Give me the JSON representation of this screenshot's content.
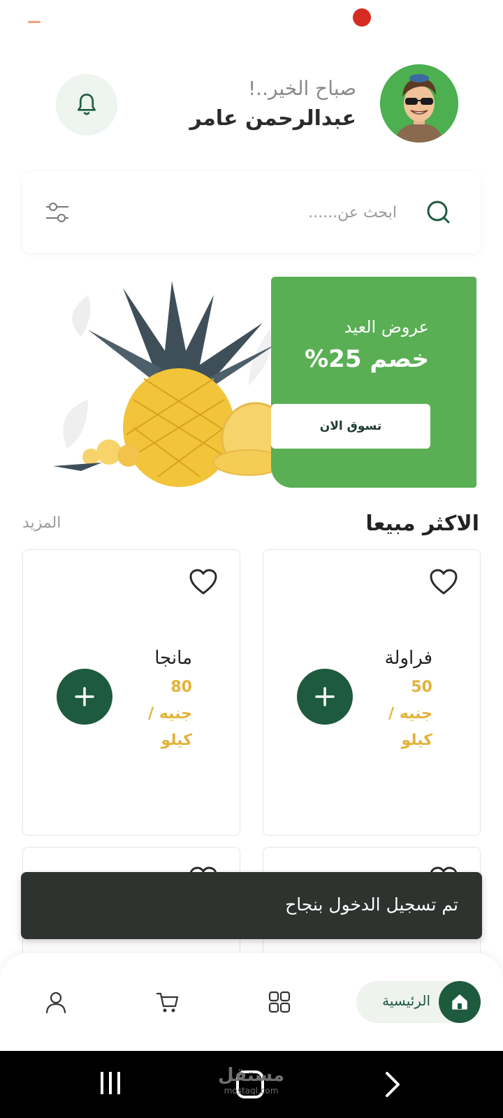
{
  "header": {
    "greeting": "صباح الخير..!",
    "username": "عبدالرحمن عامر"
  },
  "search": {
    "placeholder": "ابحث عن......"
  },
  "banner": {
    "subtitle": "عروض العيد",
    "title": "خصم 25%",
    "button_label": "تسوق الان"
  },
  "best_sellers": {
    "title": "الاكثر مبيعا",
    "more_label": "المزيد",
    "products": [
      {
        "name": "فراولة",
        "price": "50",
        "unit": "جنيه / كيلو"
      },
      {
        "name": "مانجا",
        "price": "80",
        "unit": "جنيه / كيلو"
      }
    ]
  },
  "toast": {
    "message": "تم تسجيل الدخول بنجاح"
  },
  "bottom_nav": {
    "home_label": "الرئيسية",
    "items": [
      "home-icon",
      "grid-icon",
      "cart-icon",
      "profile-icon"
    ]
  },
  "system_nav": {
    "watermark_text": "مستقل",
    "watermark_sub": "mostaql.com"
  },
  "colors": {
    "primary_green": "#1e5a3e",
    "banner_green": "#5aaf55",
    "price_gold": "#e2b33a",
    "toast_bg": "#2e332f"
  }
}
